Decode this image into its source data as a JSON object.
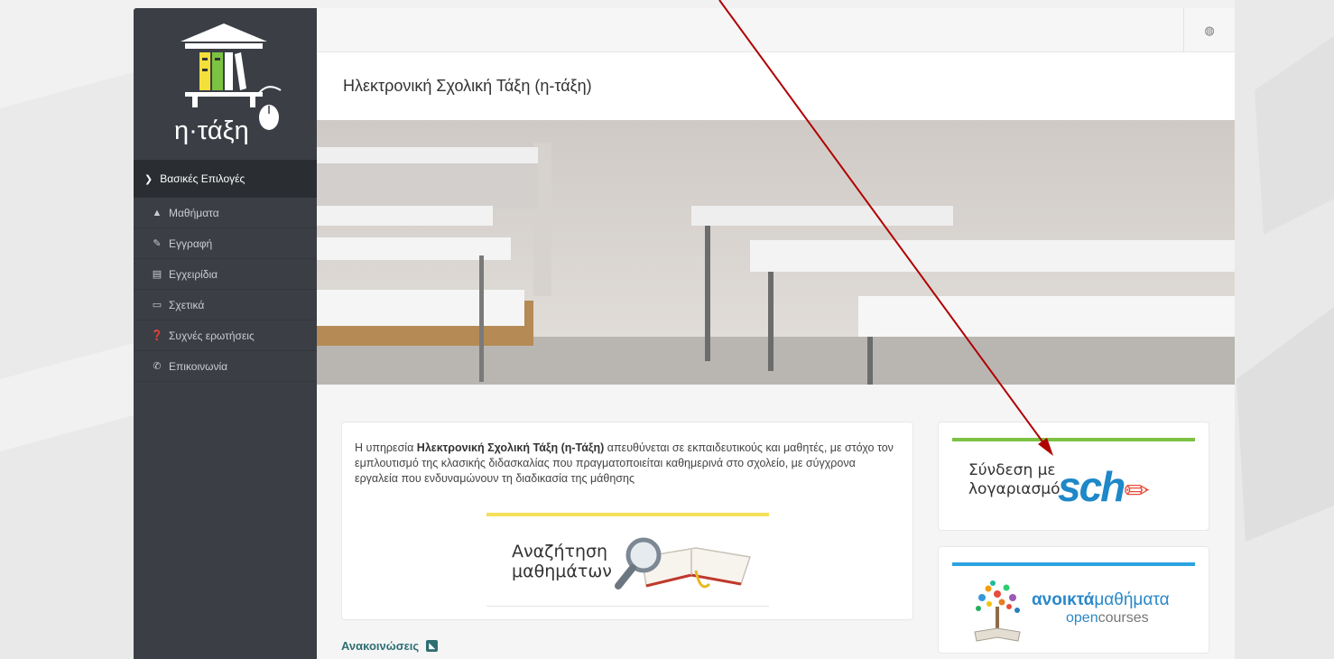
{
  "app": {
    "logo_text": "η·τάξη",
    "page_title": "Ηλεκτρονική Σχολική Τάξη (η-τάξη)"
  },
  "sidebar": {
    "header": "Βασικές Επιλογές",
    "items": [
      {
        "label": "Μαθήματα",
        "icon": "graduation-cap-icon"
      },
      {
        "label": "Εγγραφή",
        "icon": "edit-icon"
      },
      {
        "label": "Εγχειρίδια",
        "icon": "file-icon"
      },
      {
        "label": "Σχετικά",
        "icon": "credit-card-icon"
      },
      {
        "label": "Συχνές ερωτήσεις",
        "icon": "question-circle-icon"
      },
      {
        "label": "Επικοινωνία",
        "icon": "phone-icon"
      }
    ]
  },
  "intro": {
    "text_before": "Η υπηρεσία ",
    "text_bold": "Ηλεκτρονική Σχολική Τάξη (η-Τάξη)",
    "text_after": " απευθύνεται σε εκπαιδευτικούς και μαθητές, με στόχο τον εμπλουτισμό της κλασικής διδασκαλίας που πραγματοποιείται καθημερινά στο σχολείο, με σύγχρονα εργαλεία που ενδυναμώνουν τη διαδικασία της μάθησης"
  },
  "search_banner": {
    "line1": "Αναζήτηση",
    "line2": "μαθημάτων"
  },
  "announcements": {
    "label": "Ανακοινώσεις"
  },
  "sch_login": {
    "line1": "Σύνδεση με",
    "line2": "λογαριασμό",
    "logo": "sch"
  },
  "open_courses": {
    "bold": "ανοικτά",
    "rest": "μαθήματα",
    "sub_blue": "open",
    "sub_grey": "courses"
  },
  "colors": {
    "sidebar_bg": "#3b3f45",
    "arrow": "#b00000",
    "sch_green": "#7cc243",
    "open_blue": "#2aa3e0",
    "search_yellow": "#f4e05a"
  }
}
